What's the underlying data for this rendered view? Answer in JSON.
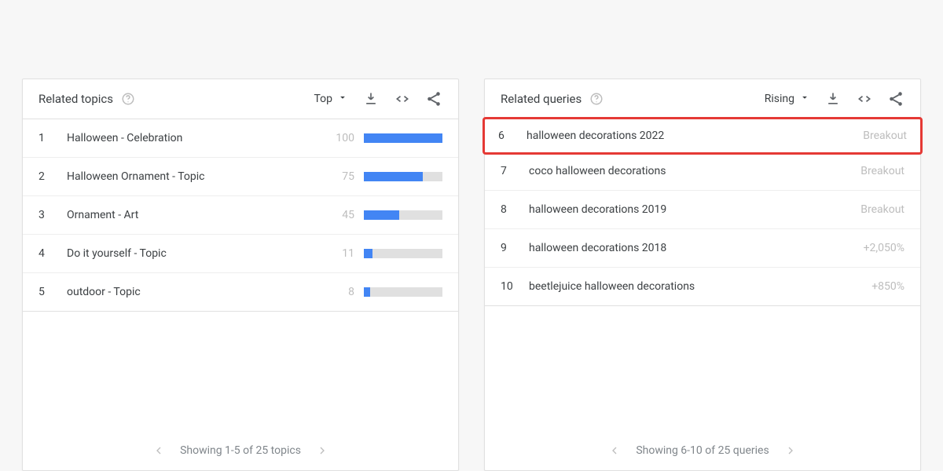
{
  "topics": {
    "title": "Related topics",
    "sort": "Top",
    "items": [
      {
        "rank": "1",
        "label": "Halloween - Celebration",
        "value": "100",
        "barPct": 100
      },
      {
        "rank": "2",
        "label": "Halloween Ornament - Topic",
        "value": "75",
        "barPct": 75
      },
      {
        "rank": "3",
        "label": "Ornament - Art",
        "value": "45",
        "barPct": 45
      },
      {
        "rank": "4",
        "label": "Do it yourself - Topic",
        "value": "11",
        "barPct": 11
      },
      {
        "rank": "5",
        "label": "outdoor - Topic",
        "value": "8",
        "barPct": 8
      }
    ],
    "footer": "Showing 1-5 of 25 topics"
  },
  "queries": {
    "title": "Related queries",
    "sort": "Rising",
    "items": [
      {
        "rank": "6",
        "label": "halloween decorations 2022",
        "metric": "Breakout",
        "highlight": true
      },
      {
        "rank": "7",
        "label": "coco halloween decorations",
        "metric": "Breakout"
      },
      {
        "rank": "8",
        "label": "halloween decorations 2019",
        "metric": "Breakout"
      },
      {
        "rank": "9",
        "label": "halloween decorations 2018",
        "metric": "+2,050%"
      },
      {
        "rank": "10",
        "label": "beetlejuice halloween decorations",
        "metric": "+850%"
      }
    ],
    "footer": "Showing 6-10 of 25 queries"
  }
}
